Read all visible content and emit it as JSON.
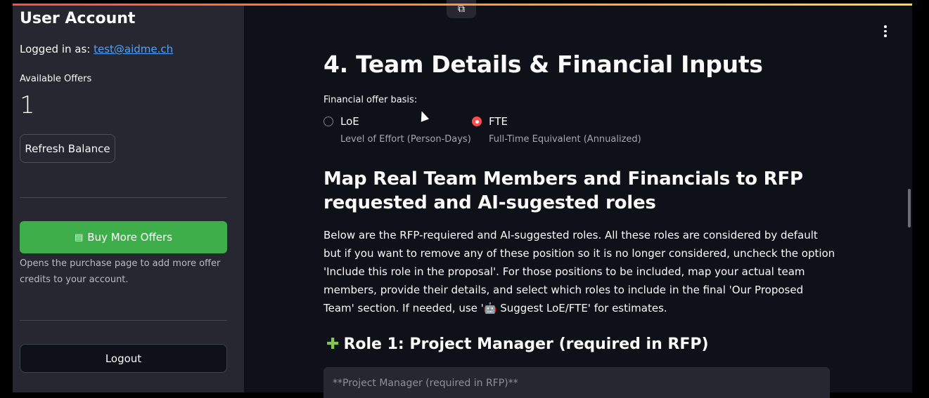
{
  "sidebar": {
    "title": "User Account",
    "logged_in_label": "Logged in as:",
    "email": "test@aidme.ch",
    "available_offers_label": "Available Offers",
    "available_offers_value": "1",
    "refresh_button": "Refresh Balance",
    "buy_button_icon": "card-icon",
    "buy_button": "Buy More Offers",
    "buy_help": "Opens the purchase page to add more offer credits to your account.",
    "logout_button": "Logout"
  },
  "main": {
    "heading": "4. Team Details & Financial Inputs",
    "financial_basis_label": "Financial offer basis:",
    "options": [
      {
        "label": "LoE",
        "caption": "Level of Effort (Person-Days)",
        "selected": false
      },
      {
        "label": "FTE",
        "caption": "Full-Time Equivalent (Annualized)",
        "selected": true
      }
    ],
    "map_heading": "Map Real Team Members and Financials to RFP requested and AI-sugested roles",
    "description": "Below are the RFP-requiered and AI-suggested roles. All these roles are considered by default but if you want to remove any of these position so it is no longer considered, uncheck the option 'Include this role in the proposal'. For those positions to be included, map your actual team members, provide their details, and select which roles to include in the final 'Our Proposed Team' section. If needed, use '🤖 Suggest LoE/FTE' for estimates.",
    "role_icon": "puzzle-icon",
    "role_heading": "Role 1: Project Manager (required in RFP)",
    "role_input_text": "**Project Manager (required in RFP)**"
  },
  "colors": {
    "accent": "#ff4b4b",
    "buy_button": "#3dae49",
    "link": "#4da3ff"
  }
}
